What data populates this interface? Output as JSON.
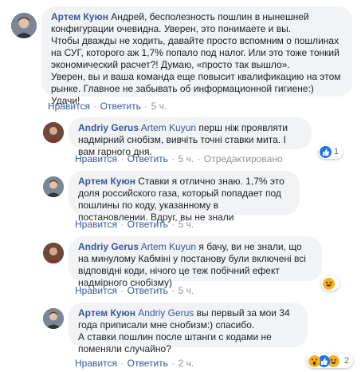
{
  "actions": {
    "like": "Нравится",
    "reply": "Ответить",
    "dot": "·"
  },
  "comments": [
    {
      "author": "Артем Куюн",
      "mention": "",
      "text": "Андрей, бесполезность пошлин в нынешней конфигурации очевидна. Уверен, это понимаете и вы.\nЧтобы дважды не ходить, давайте просто вспомним о пошлинах на СУГ, которого аж 1,7% попало под налог. Или это тоже тонкий экономический расчет?! Думаю, «просто так вышло».\nУверен, вы и ваша команда еще повысит квалификацию на этом рынке. Главное не забывать об информационной гигиене:) Удачи!",
      "time": "5 ч.",
      "edited": ""
    },
    {
      "author": "Andriy Gerus",
      "mention": "Artem Kuyun",
      "text": "перш ніж проявляти надмірний снобізм, вивчіть точні ставки мита. І вам гарного дня.",
      "time": "5 ч.",
      "edited": "Отредактировано",
      "reaction_count": "1",
      "reaction_icons": [
        "like-icon",
        "haha-icon"
      ]
    },
    {
      "author": "Артем Куюн",
      "mention": "",
      "text": "Ставки я отлично знаю. 1,7% это доля российского газа, который попадает под пошлины по коду, указанному в постановлении. Вдруг, вы не знали",
      "time": "5 ч."
    },
    {
      "author": "Andriy Gerus",
      "mention": "Artem Kuyun",
      "text": "я бачу, ви не знали, що на минулому Кабміні у постанову були включені всі відповідні коди, нічого це теж побічний ефект надмірного снобізму)",
      "time": "5 ч.",
      "reaction_count": "",
      "reaction_icons": [
        "haha-icon"
      ]
    },
    {
      "author": "Артем Куюн",
      "mention": "Andriy Gerus",
      "text": "вы первый за мои 34 года приписали мне снобизм:) спасибо.\nА ставки пошлин после штанги с кодами не поменяли случайно?",
      "time": "2 ч.",
      "reaction_count": "2",
      "reaction_icons": [
        "wow-icon",
        "like-icon",
        "haha-icon"
      ]
    }
  ]
}
